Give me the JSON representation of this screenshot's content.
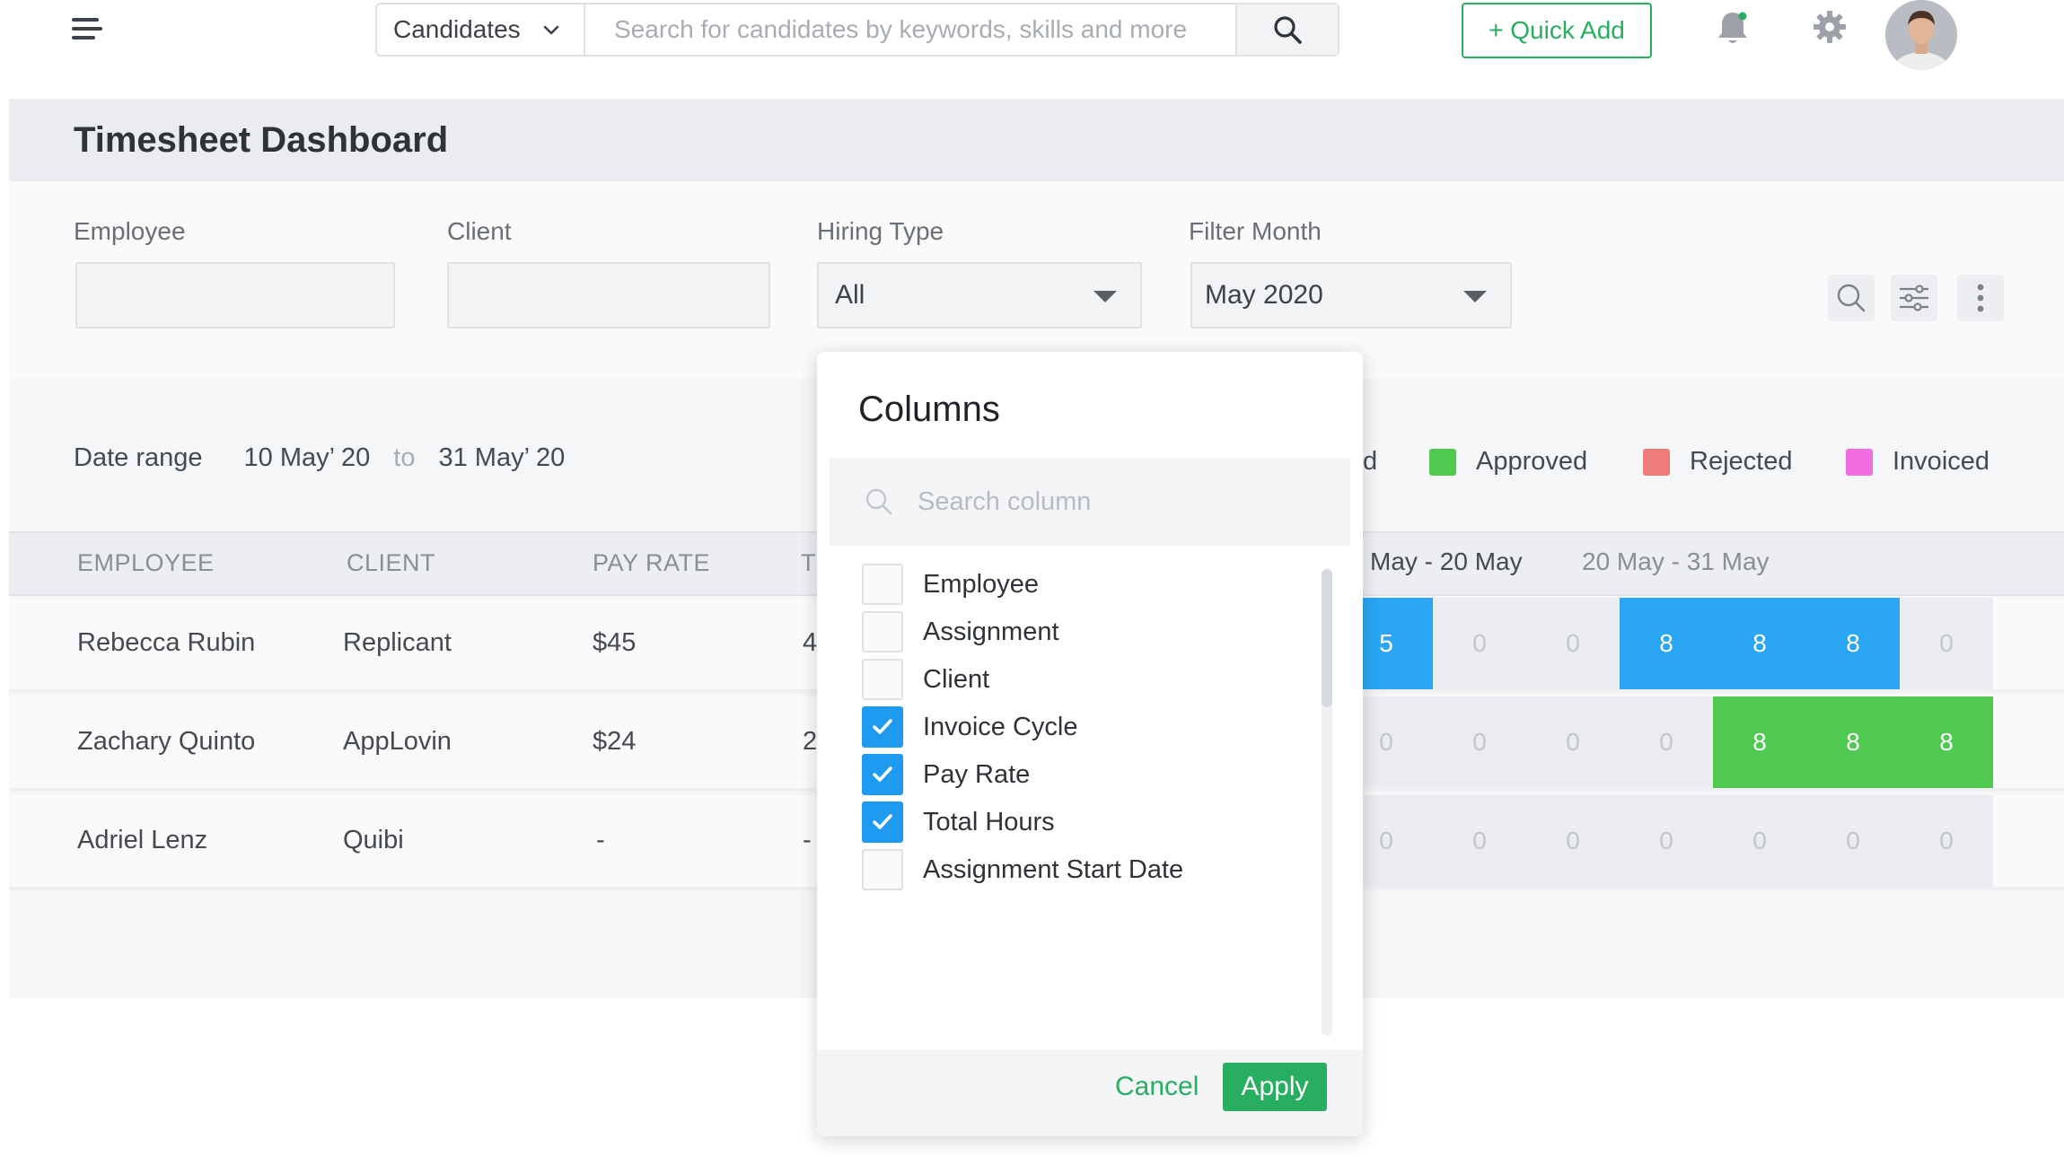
{
  "topbar": {
    "search_scope": "Candidates",
    "search_placeholder": "Search for candidates by keywords, skills and more",
    "quick_add_label": "+ Quick Add",
    "colors": {
      "accent": "#27ae60",
      "notification_dot": "#27ae60"
    },
    "icons": [
      "hamburger-menu-icon",
      "chevron-down-icon",
      "search-icon",
      "bell-icon",
      "gear-icon",
      "avatar"
    ]
  },
  "page": {
    "title": "Timesheet Dashboard"
  },
  "filters": {
    "employee_label": "Employee",
    "employee_value": "",
    "client_label": "Client",
    "client_value": "",
    "hiring_type_label": "Hiring Type",
    "hiring_type_value": "All",
    "month_label": "Filter Month",
    "month_value": "May 2020",
    "tool_icons": [
      "search-icon",
      "filter-sliders-icon",
      "kebab-menu-icon"
    ]
  },
  "date_range": {
    "label": "Date range",
    "from": "10 May’ 20",
    "to_word": "to",
    "to": "31 May’ 20"
  },
  "legend": {
    "partial_label": "d",
    "items": [
      {
        "label": "Approved",
        "color": "#4fc94f"
      },
      {
        "label": "Rejected",
        "color": "#f07b7b"
      },
      {
        "label": "Invoiced",
        "color": "#f26ee0"
      }
    ]
  },
  "table": {
    "headers": {
      "employee": "EMPLOYEE",
      "client": "CLIENT",
      "pay_rate": "PAY RATE",
      "partial": "T"
    },
    "weeks": [
      "May - 20 May",
      "20 May - 31 May"
    ],
    "rows": [
      {
        "employee": "Rebecca Rubin",
        "client": "Replicant",
        "pay_rate": "$45",
        "partial": "4",
        "cells": [
          {
            "v": "5",
            "s": "blue"
          },
          {
            "v": "0",
            "s": "empty"
          },
          {
            "v": "0",
            "s": "empty"
          },
          {
            "v": "8",
            "s": "blue"
          },
          {
            "v": "8",
            "s": "blue"
          },
          {
            "v": "8",
            "s": "blue"
          },
          {
            "v": "0",
            "s": "empty"
          }
        ]
      },
      {
        "employee": "Zachary Quinto",
        "client": "AppLovin",
        "pay_rate": "$24",
        "partial": "2",
        "cells": [
          {
            "v": "0",
            "s": "empty"
          },
          {
            "v": "0",
            "s": "empty"
          },
          {
            "v": "0",
            "s": "empty"
          },
          {
            "v": "0",
            "s": "empty"
          },
          {
            "v": "8",
            "s": "green"
          },
          {
            "v": "8",
            "s": "green"
          },
          {
            "v": "8",
            "s": "green"
          }
        ]
      },
      {
        "employee": "Adriel Lenz",
        "client": "Quibi",
        "pay_rate": "-",
        "partial": "-",
        "cells": [
          {
            "v": "0",
            "s": "empty"
          },
          {
            "v": "0",
            "s": "empty"
          },
          {
            "v": "0",
            "s": "empty"
          },
          {
            "v": "0",
            "s": "empty"
          },
          {
            "v": "0",
            "s": "empty"
          },
          {
            "v": "0",
            "s": "empty"
          },
          {
            "v": "0",
            "s": "empty"
          }
        ]
      }
    ],
    "colors": {
      "submitted": "#2aa6f5",
      "approved": "#4fc94f",
      "empty": "#eaecef"
    }
  },
  "columns_popup": {
    "title": "Columns",
    "search_placeholder": "Search column",
    "items": [
      {
        "label": "Employee",
        "checked": false
      },
      {
        "label": "Assignment",
        "checked": false
      },
      {
        "label": "Client",
        "checked": false
      },
      {
        "label": "Invoice Cycle",
        "checked": true
      },
      {
        "label": "Pay Rate",
        "checked": true
      },
      {
        "label": "Total Hours",
        "checked": true
      },
      {
        "label": "Assignment Start Date",
        "checked": false
      }
    ],
    "cancel_label": "Cancel",
    "apply_label": "Apply"
  }
}
